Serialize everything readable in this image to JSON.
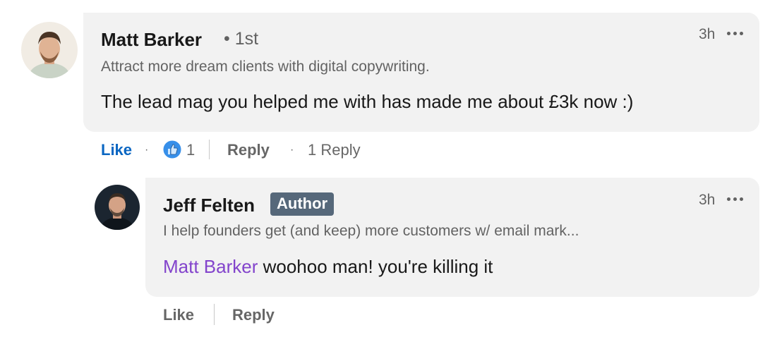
{
  "comment": {
    "author_name": "Matt Barker",
    "degree": "• 1st",
    "headline": "Attract more dream clients with digital copywriting.",
    "text": "The lead mag you helped me with has made me about £3k now :)",
    "time": "3h",
    "actions": {
      "like_label": "Like",
      "reaction_count": "1",
      "reply_label": "Reply",
      "reply_count_label": "1 Reply"
    }
  },
  "reply": {
    "author_name": "Jeff Felten",
    "badge": "Author",
    "headline": "I help founders get (and keep) more customers w/ email mark...",
    "mention": "Matt Barker",
    "text": " woohoo man! you're killing it",
    "time": "3h",
    "actions": {
      "like_label": "Like",
      "reply_label": "Reply"
    }
  },
  "icons": {
    "more": "ellipsis-icon",
    "reaction": "thumbs-up-icon"
  },
  "colors": {
    "like_active": "#0a66c2",
    "mention": "#8344cc",
    "badge_bg": "#56687a",
    "bubble_bg": "#f2f2f2"
  }
}
